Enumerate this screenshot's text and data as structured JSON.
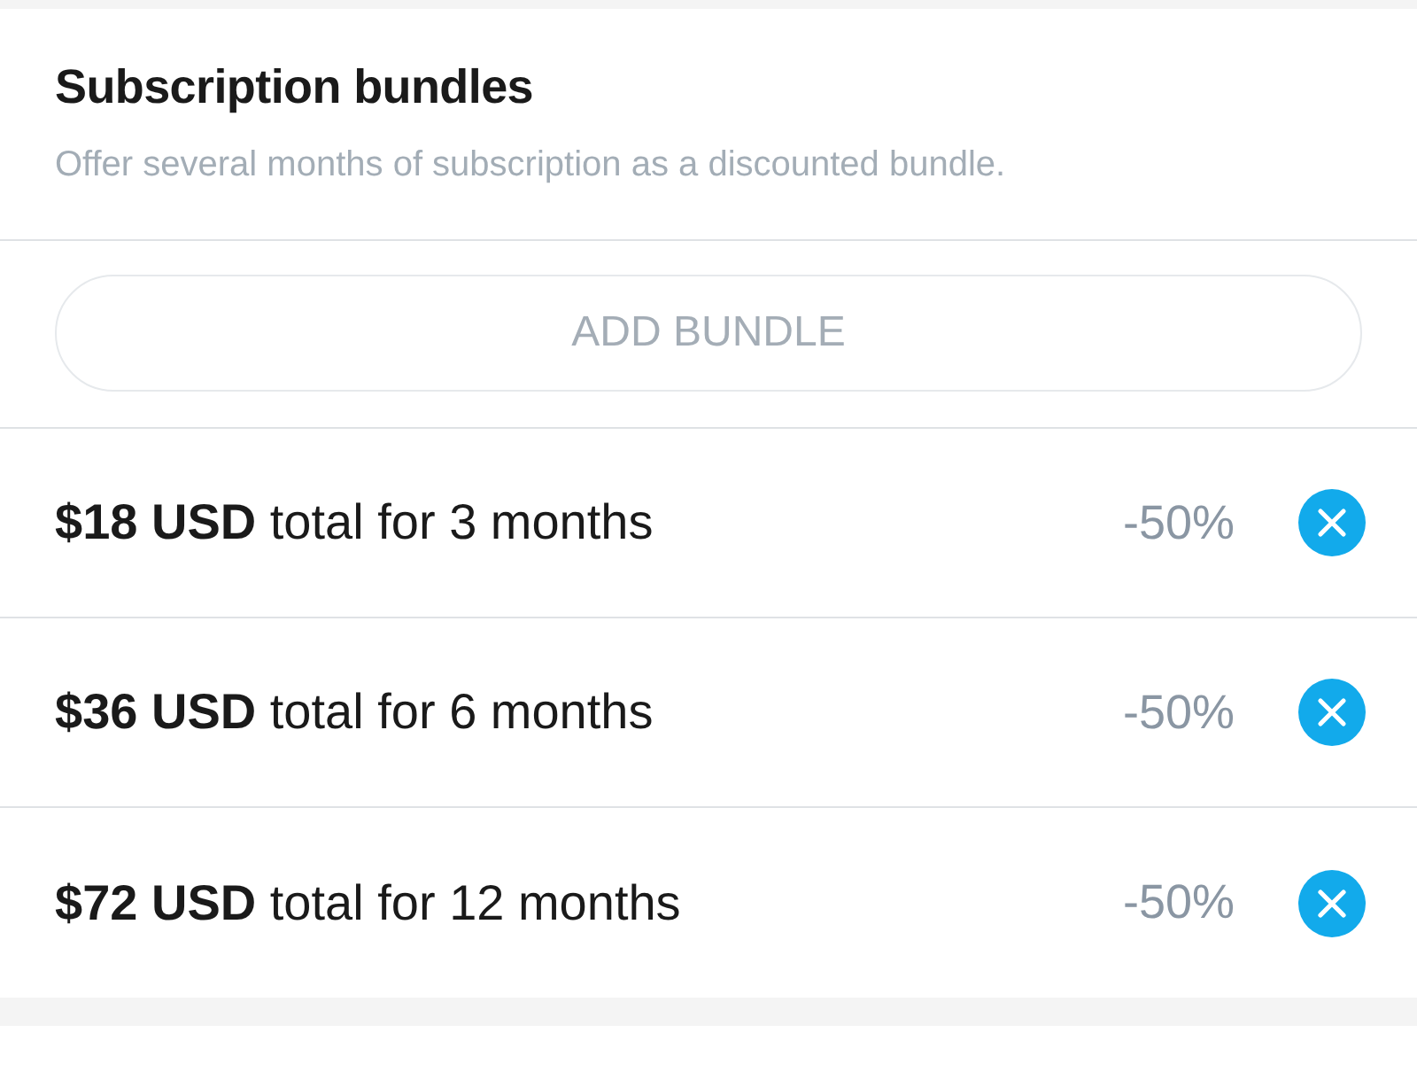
{
  "section": {
    "title": "Subscription bundles",
    "description": "Offer several months of subscription as a discounted bundle."
  },
  "add_button": {
    "label": "ADD BUNDLE",
    "disabled": true
  },
  "bundles": [
    {
      "text": "**$18 USD** total for 3 months",
      "discount": "-50%"
    },
    {
      "text": "**$36 USD** total for 6 months",
      "discount": "-50%"
    },
    {
      "text": "**$72 USD** total for 12 months",
      "discount": "-50%"
    }
  ]
}
